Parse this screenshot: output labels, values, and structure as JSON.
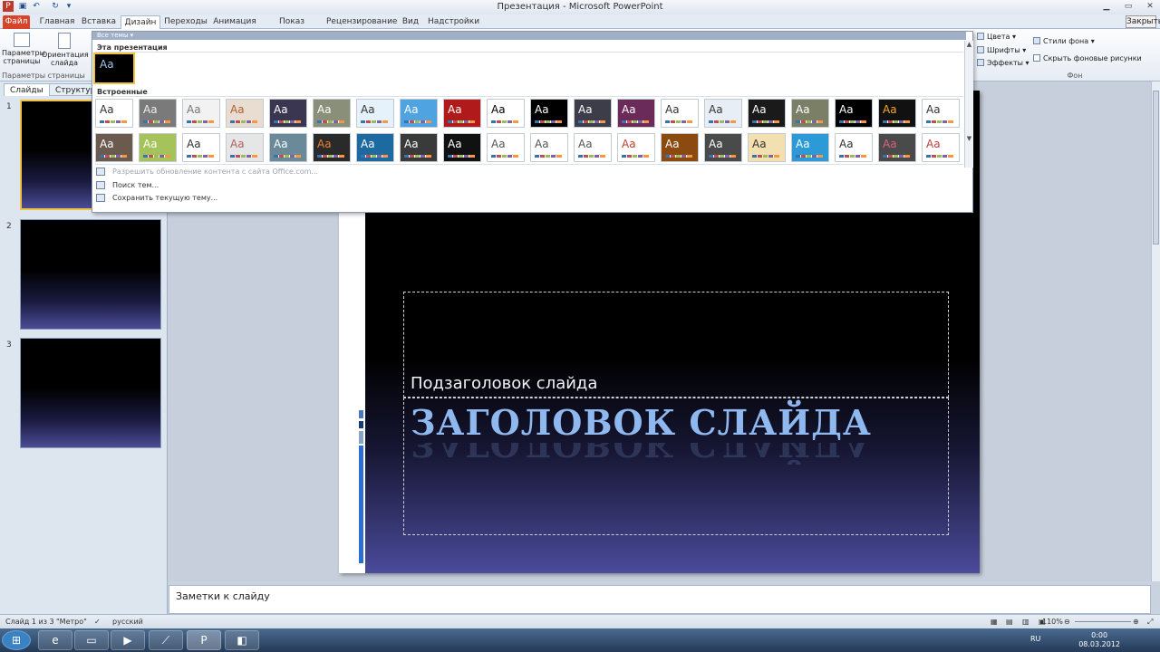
{
  "window": {
    "title": "Презентация  -  Microsoft PowerPoint",
    "close_label": "Закрыть"
  },
  "tabs": [
    "Файл",
    "Главная",
    "Вставка",
    "Дизайн",
    "Переходы",
    "Анимация",
    "Показ слайдов",
    "Рецензирование",
    "Вид",
    "Надстройки"
  ],
  "ribbon": {
    "page_setup": "Параметры страницы",
    "orientation": "Ориентация слайда",
    "group_page": "Параметры страницы",
    "colors": "Цвета",
    "fonts": "Шрифты",
    "effects": "Эффекты",
    "bg_styles": "Стили фона",
    "hide_bg": "Скрыть фоновые рисунки",
    "group_bg": "Фон"
  },
  "gallery": {
    "header": "Все темы",
    "this_presentation": "Эта презентация",
    "builtin": "Встроенные",
    "aa": "Aa",
    "menu": {
      "enable_updates": "Разрешить обновление контента с сайта Office.com...",
      "browse": "Поиск тем...",
      "save": "Сохранить текущую тему..."
    }
  },
  "left_pane": {
    "tab_slides": "Слайды",
    "tab_outline": "Структура",
    "slide_numbers": [
      "1",
      "2",
      "3"
    ]
  },
  "slide": {
    "subtitle": "Подзаголовок слайда",
    "title": "ЗАГОЛОВОК СЛАЙДА"
  },
  "notes": {
    "text": "Заметки к слайду"
  },
  "status": {
    "slide": "Слайд 1 из 3",
    "theme": "\"Метро\"",
    "language": "русский",
    "zoom": "110%"
  },
  "taskbar": {
    "lang": "RU",
    "time": "0:00",
    "date": "08.03.2012"
  }
}
